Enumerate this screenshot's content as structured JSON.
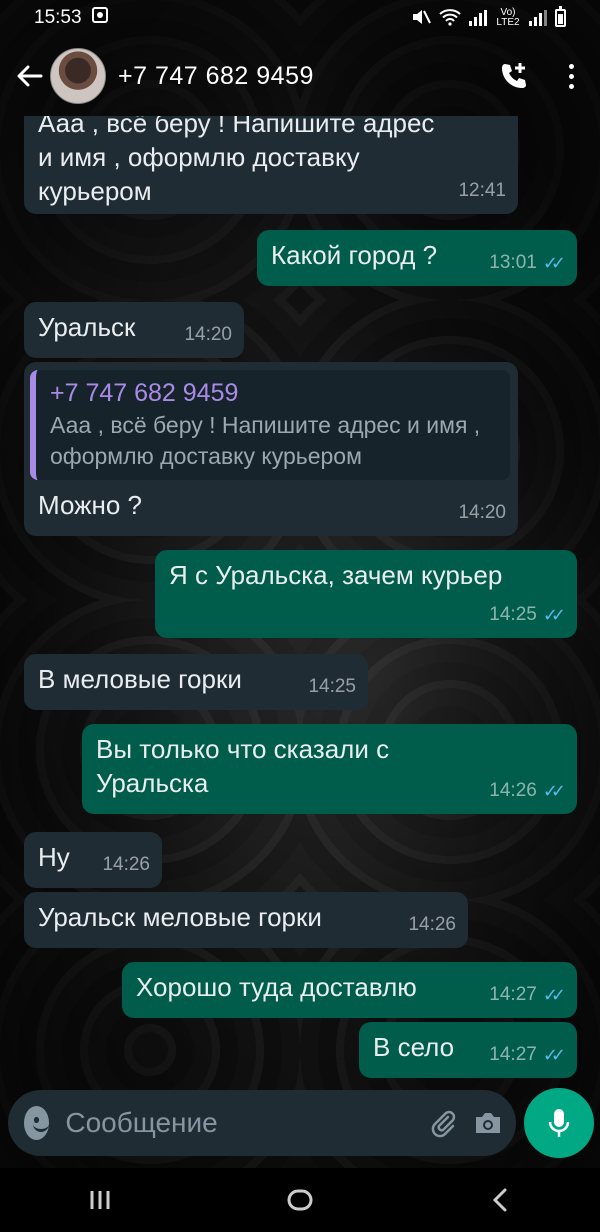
{
  "status_bar": {
    "time": "15:53",
    "network_label": "Vo) LTE2"
  },
  "header": {
    "contact_name": "+7 747 682 9459"
  },
  "messages": [
    {
      "direction": "in",
      "text_partial_top": "Ааа , всё  беру ! Напишите адрес",
      "text": "и имя , оформлю доставку курьером",
      "time": "12:41"
    },
    {
      "direction": "out",
      "text": "Какой город ?",
      "time": "13:01",
      "status": "read"
    },
    {
      "direction": "in",
      "text": "Уральск",
      "time": "14:20"
    },
    {
      "direction": "in",
      "quote_author": "+7 747 682 9459",
      "quote_text": "Ааа , всё  беру ! Напишите адрес и имя , оформлю доставку курьером",
      "text": "Можно ?",
      "time": "14:20"
    },
    {
      "direction": "out",
      "text": "Я с Уральска,  зачем курьер",
      "time": "14:25",
      "status": "read"
    },
    {
      "direction": "in",
      "text": "В меловые горки",
      "time": "14:25"
    },
    {
      "direction": "out",
      "text": "Вы только что сказали с Уральска",
      "time": "14:26",
      "status": "read"
    },
    {
      "direction": "in",
      "text": "Ну",
      "time": "14:26"
    },
    {
      "direction": "in",
      "text": "Уральск меловые горки",
      "time": "14:26"
    },
    {
      "direction": "out",
      "text": "Хорошо туда доставлю",
      "time": "14:27",
      "status": "read"
    },
    {
      "direction": "out",
      "text": "В село",
      "time": "14:27",
      "status": "read"
    }
  ],
  "input": {
    "placeholder": "Сообщение"
  },
  "colors": {
    "incoming_bubble": "#1f2c34",
    "outgoing_bubble": "#005c4b",
    "accent_green": "#00a884",
    "read_ticks": "#53bdeb",
    "quote_accent": "#a98be7"
  },
  "icons": {
    "back": "back-arrow-icon",
    "call": "add-call-icon",
    "menu": "more-vert-icon",
    "emoji": "emoji-icon",
    "attach": "paperclip-icon",
    "camera": "camera-icon",
    "mic": "microphone-icon",
    "nav_recent": "recent-apps-icon",
    "nav_home": "home-icon",
    "nav_back": "nav-back-icon"
  }
}
